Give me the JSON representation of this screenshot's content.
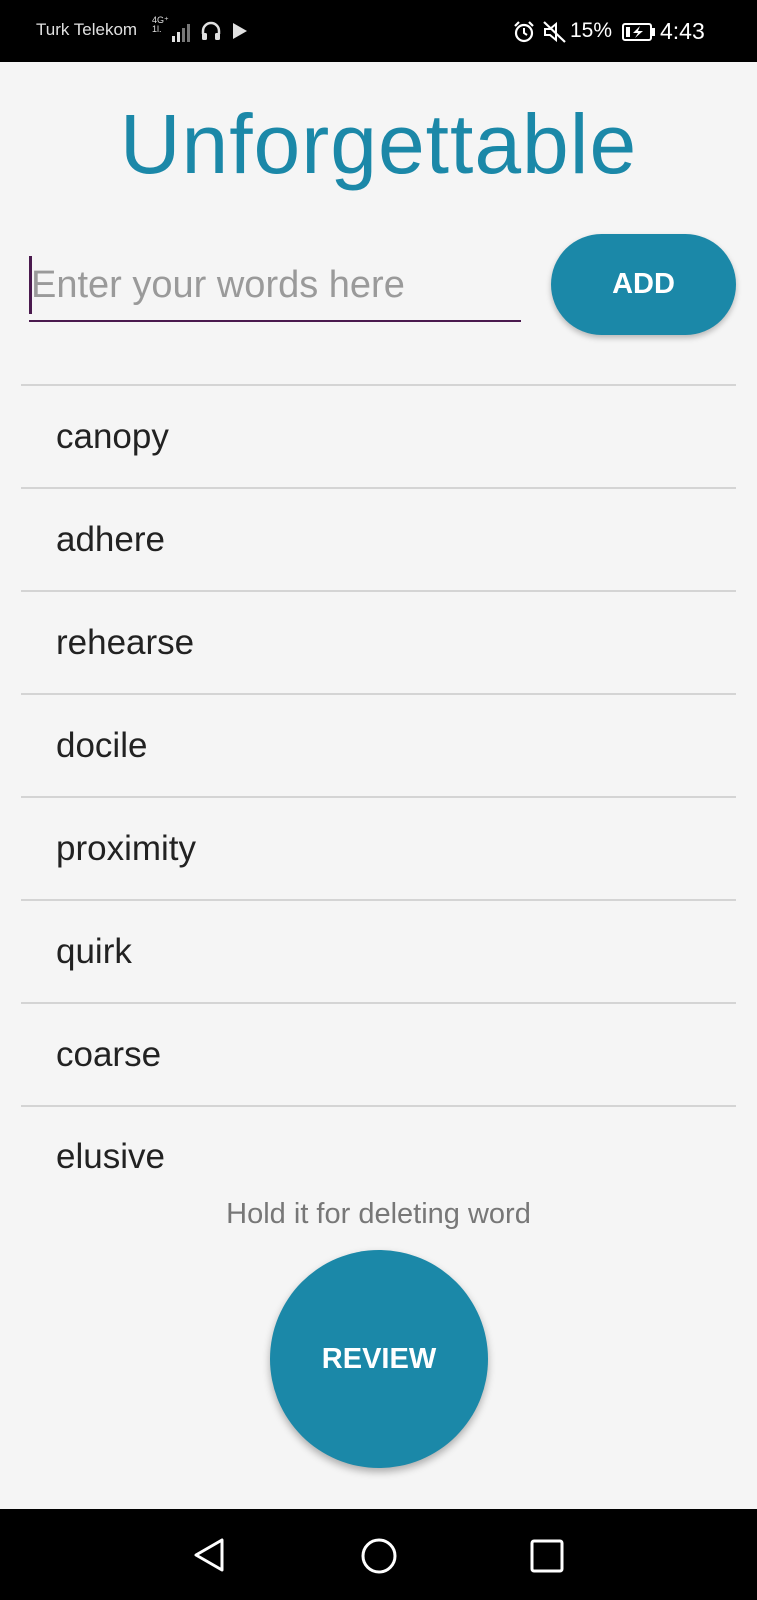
{
  "status_bar": {
    "carrier": "Turk Telekom",
    "network_badge_top": "4G⁺",
    "network_badge_bottom": "1l.",
    "battery_percent": "15%",
    "time": "4:43",
    "icons": [
      "signal-icon",
      "headset-icon",
      "play-icon",
      "alarm-icon",
      "mute-icon",
      "battery-charging-icon"
    ]
  },
  "app": {
    "title": "Unforgettable",
    "accent_color": "#1b88a8"
  },
  "input": {
    "value": "",
    "placeholder": "Enter your words here"
  },
  "add_button": {
    "label": "ADD"
  },
  "words": [
    "canopy",
    "adhere",
    "rehearse",
    "docile",
    "proximity",
    "quirk",
    "coarse",
    "elusive"
  ],
  "hint": "Hold it for deleting word",
  "review_button": {
    "label": "REVIEW"
  },
  "nav_bar": {
    "icons": [
      "back-icon",
      "home-icon",
      "recents-icon"
    ]
  }
}
